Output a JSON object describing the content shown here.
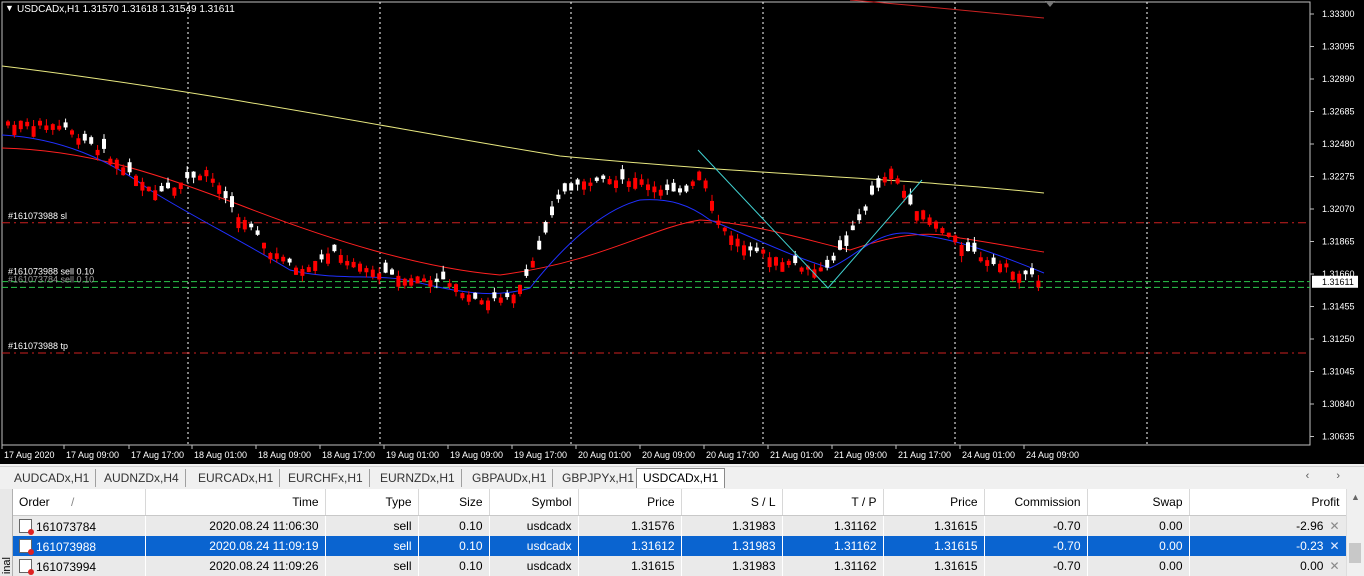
{
  "chart": {
    "header": "USDCADx,H1  1.31570 1.31618 1.31549 1.31611",
    "current_price": "1.31611",
    "price_labels": [
      "1.33300",
      "1.33095",
      "1.32890",
      "1.32685",
      "1.32480",
      "1.32275",
      "1.32070",
      "1.31865",
      "1.31660",
      "1.31455",
      "1.31250",
      "1.31045",
      "1.30840",
      "1.30635"
    ],
    "time_labels": [
      "17 Aug 2020",
      "17 Aug 09:00",
      "17 Aug 17:00",
      "18 Aug 01:00",
      "18 Aug 09:00",
      "18 Aug 17:00",
      "19 Aug 01:00",
      "19 Aug 09:00",
      "19 Aug 17:00",
      "20 Aug 01:00",
      "20 Aug 09:00",
      "20 Aug 17:00",
      "21 Aug 01:00",
      "21 Aug 09:00",
      "21 Aug 17:00",
      "24 Aug 01:00",
      "24 Aug 09:00"
    ],
    "order_labels": {
      "sl": "#161073988 sl",
      "sell": "#161073988 sell 0.10",
      "sell2": "#161073784 sell 0.10",
      "tp": "#161073988 tp"
    },
    "colors": {
      "bull": "#ffffff",
      "bear": "#ff0000",
      "ma_fast": "#2030ff",
      "ma_mid": "#ff2020",
      "ma_slow": "#e8e880",
      "ma_far": "#cc2222",
      "entry": "#2cc84c",
      "sltp": "#cc2020",
      "trend": "#40d0d0"
    }
  },
  "tabs": [
    "AUDCADx,H1",
    "AUDNZDx,H4",
    "EURCADx,H1",
    "EURCHFx,H1",
    "EURNZDx,H1",
    "GBPAUDx,H1",
    "GBPJPYx,H1",
    "USDCADx,H1"
  ],
  "active_tab": "USDCADx,H1",
  "terminal_label": "inal",
  "columns": [
    "Order",
    "Time",
    "Type",
    "Size",
    "Symbol",
    "Price",
    "S / L",
    "T / P",
    "Price",
    "Commission",
    "Swap",
    "Profit"
  ],
  "sort_marker": "/",
  "orders": [
    {
      "order": "161073784",
      "time": "2020.08.24 11:06:30",
      "type": "sell",
      "size": "0.10",
      "symbol": "usdcadx",
      "price": "1.31576",
      "sl": "1.31983",
      "tp": "1.31162",
      "cur_price": "1.31615",
      "commission": "-0.70",
      "swap": "0.00",
      "profit": "-2.96"
    },
    {
      "order": "161073988",
      "time": "2020.08.24 11:09:19",
      "type": "sell",
      "size": "0.10",
      "symbol": "usdcadx",
      "price": "1.31612",
      "sl": "1.31983",
      "tp": "1.31162",
      "cur_price": "1.31615",
      "commission": "-0.70",
      "swap": "0.00",
      "profit": "-0.23"
    },
    {
      "order": "161073994",
      "time": "2020.08.24 11:09:26",
      "type": "sell",
      "size": "0.10",
      "symbol": "usdcadx",
      "price": "1.31615",
      "sl": "1.31983",
      "tp": "1.31162",
      "cur_price": "1.31615",
      "commission": "-0.70",
      "swap": "0.00",
      "profit": "0.00"
    }
  ],
  "selected_order": "161073988",
  "close_glyph": "✕"
}
